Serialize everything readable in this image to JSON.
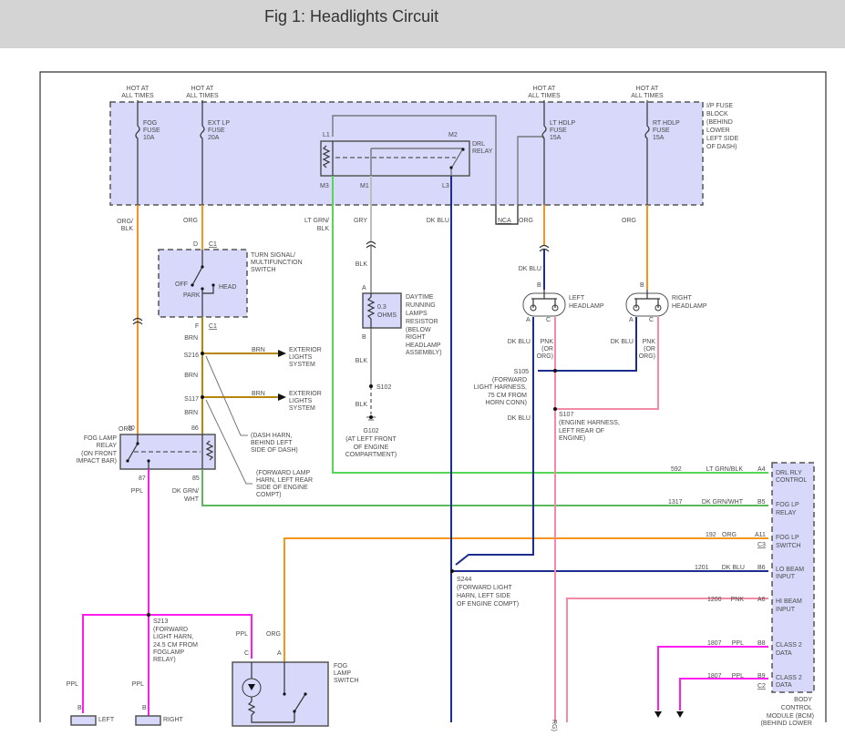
{
  "title": "Fig 1: Headlights Circuit",
  "hot": [
    "HOT AT",
    "ALL TIMES"
  ],
  "fuses": {
    "fog": [
      "FOG",
      "FUSE",
      "10A"
    ],
    "ext_lp": [
      "EXT LP",
      "FUSE",
      "20A"
    ],
    "lt_hdlp": [
      "LT HDLP",
      "FUSE",
      "15A"
    ],
    "rt_hdlp": [
      "RT HDLP",
      "FUSE",
      "15A"
    ]
  },
  "fuse_block": [
    "I/P FUSE",
    "BLOCK",
    "(BEHIND",
    "LOWER",
    "LEFT SIDE",
    "OF DASH)"
  ],
  "drl_relay": {
    "name": [
      "DRL",
      "RELAY"
    ],
    "l1": "L1",
    "m2": "M2",
    "m3": "M3",
    "m1": "M1",
    "l3": "L3"
  },
  "nca": "NCA",
  "turn_switch": {
    "name": [
      "TURN SIGNAL/",
      "MULTIFUNCTION",
      "SWITCH"
    ],
    "off": "OFF",
    "park": "PARK",
    "head": "HEAD",
    "pin_d": "D",
    "pin_f": "F",
    "conn": "C1"
  },
  "resistor": {
    "value": [
      "0.3",
      "OHMS"
    ],
    "name": [
      "DAYTIME",
      "RUNNING",
      "LAMPS",
      "RESISTOR",
      "(BELOW",
      "RIGHT",
      "HEADLAMP",
      "ASSEMBLY)"
    ],
    "pin_a": "A",
    "pin_b": "B"
  },
  "wires": {
    "org_blk": [
      "ORG/",
      "BLK"
    ],
    "org": "ORG",
    "lt_grn_blk": [
      "LT GRN/",
      "BLK"
    ],
    "gry": "GRY",
    "dk_blu": "DK BLU",
    "blk": "BLK",
    "brn": "BRN",
    "pnk": "PNK",
    "or_org": [
      "(OR",
      "ORG)"
    ],
    "dk_grn_wht": [
      "DK GRN/",
      "WHT"
    ],
    "ppl": "PPL"
  },
  "splices": {
    "s216": "S216",
    "s117": "S117",
    "s102": "S102",
    "g102": [
      "G102",
      "(AT LEFT FRONT",
      "OF ENGINE",
      "COMPARTMENT)"
    ],
    "s105": [
      "S105",
      "(FORWARD",
      "LIGHT HARNESS,",
      "75 CM FROM",
      "HORN CONN)"
    ],
    "s107": [
      "S107",
      "(ENGINE HARNESS,",
      "LEFT REAR OF",
      "ENGINE)"
    ],
    "s244": [
      "S244",
      "(FORWARD LIGHT",
      "HARN, LEFT SIDE",
      "OF ENGINE COMPT)"
    ],
    "s213": [
      "S213",
      "(FORWARD",
      "LIGHT HARN,",
      "24.5 CM FROM",
      "FOGLAMP",
      "RELAY)"
    ],
    "dash_harn": [
      "(DASH HARN,",
      "BEHIND LEFT",
      "SIDE OF DASH)"
    ],
    "fwd_lamp_harn": [
      "(FORWARD LAMP",
      "HARN, LEFT REAR",
      "SIDE OF ENGINE",
      "COMPT)"
    ]
  },
  "exterior_lights": [
    "EXTERIOR",
    "LIGHTS",
    "SYSTEM"
  ],
  "headlamps": {
    "left": [
      "LEFT",
      "HEADLAMP"
    ],
    "right": [
      "RIGHT",
      "HEADLAMP"
    ],
    "pin_a": "A",
    "pin_b": "B",
    "pin_c": "C"
  },
  "fog_relay": {
    "name": [
      "FOG LAMP",
      "RELAY",
      "(ON FRONT",
      "IMPACT BAR)"
    ],
    "p30": "30",
    "p86": "86",
    "p87": "87",
    "p85": "85"
  },
  "fog_switch": {
    "name": [
      "FOG",
      "LAMP",
      "SWITCH"
    ],
    "pin_c": "C",
    "pin_a": "A"
  },
  "fog_lamps": {
    "left": "LEFT",
    "right": "RIGHT",
    "pin_b": "B"
  },
  "bcm": {
    "name": [
      "BODY",
      "CONTROL",
      "MODULE (BCM)",
      "(BEHIND LOWER"
    ],
    "circuits": [
      {
        "circuit": "592",
        "color": "LT GRN/BLK",
        "pin": "A4",
        "label": [
          "DRL RLY",
          "CONTROL"
        ]
      },
      {
        "circuit": "1317",
        "color": "DK GRN/WHT",
        "pin": "B5",
        "label": [
          "FOG LP",
          "RELAY"
        ]
      },
      {
        "circuit": "192",
        "color": "ORG",
        "pin": "A11",
        "conn": "C3",
        "label": [
          "FOG LP",
          "SWITCH"
        ]
      },
      {
        "circuit": "1201",
        "color": "DK BLU",
        "pin": "B6",
        "label": [
          "LO BEAM",
          "INPUT"
        ]
      },
      {
        "circuit": "1200",
        "color": "PNK",
        "pin": "A6",
        "label": [
          "HI BEAM",
          "INPUT"
        ]
      },
      {
        "circuit": "1807",
        "color": "PPL",
        "pin": "B8",
        "label": [
          "CLASS 2",
          "DATA"
        ]
      },
      {
        "circuit": "1807",
        "color": "PPL",
        "pin": "B9",
        "conn": "C2",
        "label": [
          "CLASS 2",
          "DATA"
        ]
      }
    ]
  },
  "cut_label": "RG)",
  "wire_colors": {
    "org": "#f7941d",
    "brn": "#b8860b",
    "lt_grn": "#55d655",
    "dk_grn": "#5cb85c",
    "dk_blu": "#1c2d8f",
    "pnk": "#f48aa6",
    "ppl": "#ff1cf0",
    "gry": "#bdbdbd",
    "module_fill": "#d8d8fa"
  }
}
